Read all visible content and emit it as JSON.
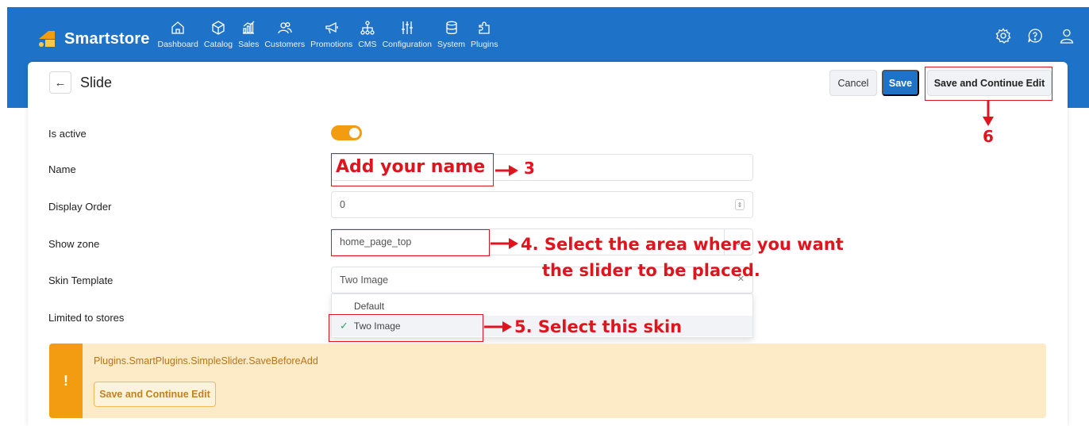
{
  "brand": {
    "name": "Smartstore"
  },
  "nav": [
    {
      "label": "Dashboard",
      "icon": "home-icon"
    },
    {
      "label": "Catalog",
      "icon": "box-icon"
    },
    {
      "label": "Sales",
      "icon": "chart-icon"
    },
    {
      "label": "Customers",
      "icon": "users-icon"
    },
    {
      "label": "Promotions",
      "icon": "megaphone-icon"
    },
    {
      "label": "CMS",
      "icon": "sitemap-icon"
    },
    {
      "label": "Configuration",
      "icon": "sliders-icon"
    },
    {
      "label": "System",
      "icon": "database-icon"
    },
    {
      "label": "Plugins",
      "icon": "puzzle-icon"
    }
  ],
  "page": {
    "title": "Slide",
    "cancel_label": "Cancel",
    "save_label": "Save",
    "save_continue_label": "Save and Continue Edit"
  },
  "form": {
    "is_active_label": "Is active",
    "is_active": true,
    "name_label": "Name",
    "name_value": "",
    "display_order_label": "Display Order",
    "display_order_value": "0",
    "show_zone_label": "Show zone",
    "show_zone_value": "home_page_top",
    "skin_template_label": "Skin Template",
    "skin_template_value": "Two Image",
    "limited_label": "Limited to stores",
    "skin_options": [
      "Default",
      "Two Image"
    ]
  },
  "alert": {
    "message": "Plugins.SmartPlugins.SimpleSlider.SaveBeforeAdd",
    "button_label": "Save and Continue Edit",
    "icon": "!"
  },
  "annotations": {
    "name_note": "Add your name",
    "step3": "3",
    "step4_line1": "4. Select the area where you want",
    "step4_line2": "the slider to be placed.",
    "step5": "5. Select this skin",
    "step6": "6"
  },
  "colors": {
    "brand_blue": "#1e73c8",
    "accent_orange": "#f39c12",
    "annotation_red": "#e0141e",
    "alert_bg": "#fdebc7"
  }
}
